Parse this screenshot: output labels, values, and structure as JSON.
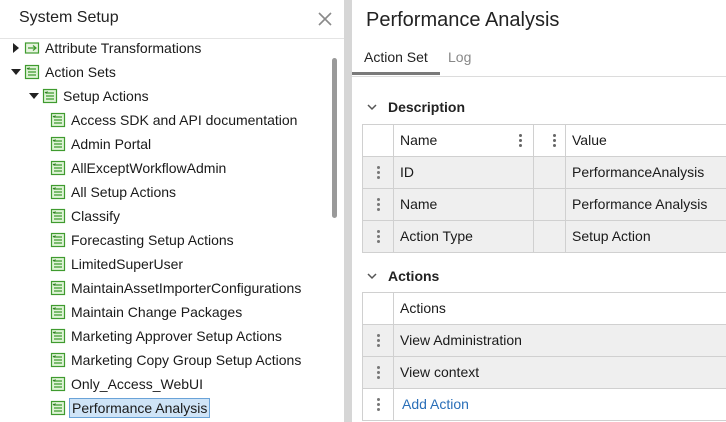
{
  "left_panel": {
    "title": "System Setup",
    "tree": [
      {
        "label": "Attribute Transformations",
        "level": 0,
        "expander": "collapsed"
      },
      {
        "label": "Action Sets",
        "level": 0,
        "expander": "expanded"
      },
      {
        "label": "Setup Actions",
        "level": 1,
        "expander": "expanded"
      },
      {
        "label": "Access SDK and API documentation",
        "level": 2,
        "expander": "none"
      },
      {
        "label": "Admin Portal",
        "level": 2,
        "expander": "none"
      },
      {
        "label": "AllExceptWorkflowAdmin",
        "level": 2,
        "expander": "none"
      },
      {
        "label": "All Setup Actions",
        "level": 2,
        "expander": "none"
      },
      {
        "label": "Classify",
        "level": 2,
        "expander": "none"
      },
      {
        "label": "Forecasting Setup Actions",
        "level": 2,
        "expander": "none"
      },
      {
        "label": "LimitedSuperUser",
        "level": 2,
        "expander": "none"
      },
      {
        "label": "MaintainAssetImporterConfigurations",
        "level": 2,
        "expander": "none"
      },
      {
        "label": "Maintain Change Packages",
        "level": 2,
        "expander": "none"
      },
      {
        "label": "Marketing Approver Setup Actions",
        "level": 2,
        "expander": "none"
      },
      {
        "label": "Marketing Copy Group Setup Actions",
        "level": 2,
        "expander": "none"
      },
      {
        "label": "Only_Access_WebUI",
        "level": 2,
        "expander": "none"
      },
      {
        "label": "Performance Analysis",
        "level": 2,
        "expander": "none",
        "selected": true
      }
    ]
  },
  "right_panel": {
    "title": "Performance Analysis",
    "tabs": [
      {
        "label": "Action Set",
        "active": true
      },
      {
        "label": "Log",
        "active": false
      }
    ],
    "description": {
      "heading": "Description",
      "columns": {
        "name": "Name",
        "value": "Value"
      },
      "rows": [
        {
          "name": "ID",
          "value": "PerformanceAnalysis"
        },
        {
          "name": "Name",
          "value": "Performance Analysis"
        },
        {
          "name": "Action Type",
          "value": "Setup Action"
        }
      ]
    },
    "actions": {
      "heading": "Actions",
      "column": "Actions",
      "rows": [
        "View Administration",
        "View context"
      ],
      "add_label": "Add Action"
    }
  },
  "colors": {
    "accent_link": "#2a6fb8",
    "selection_bg": "#cfe4f7",
    "icon_green": "#3f9b2f"
  }
}
